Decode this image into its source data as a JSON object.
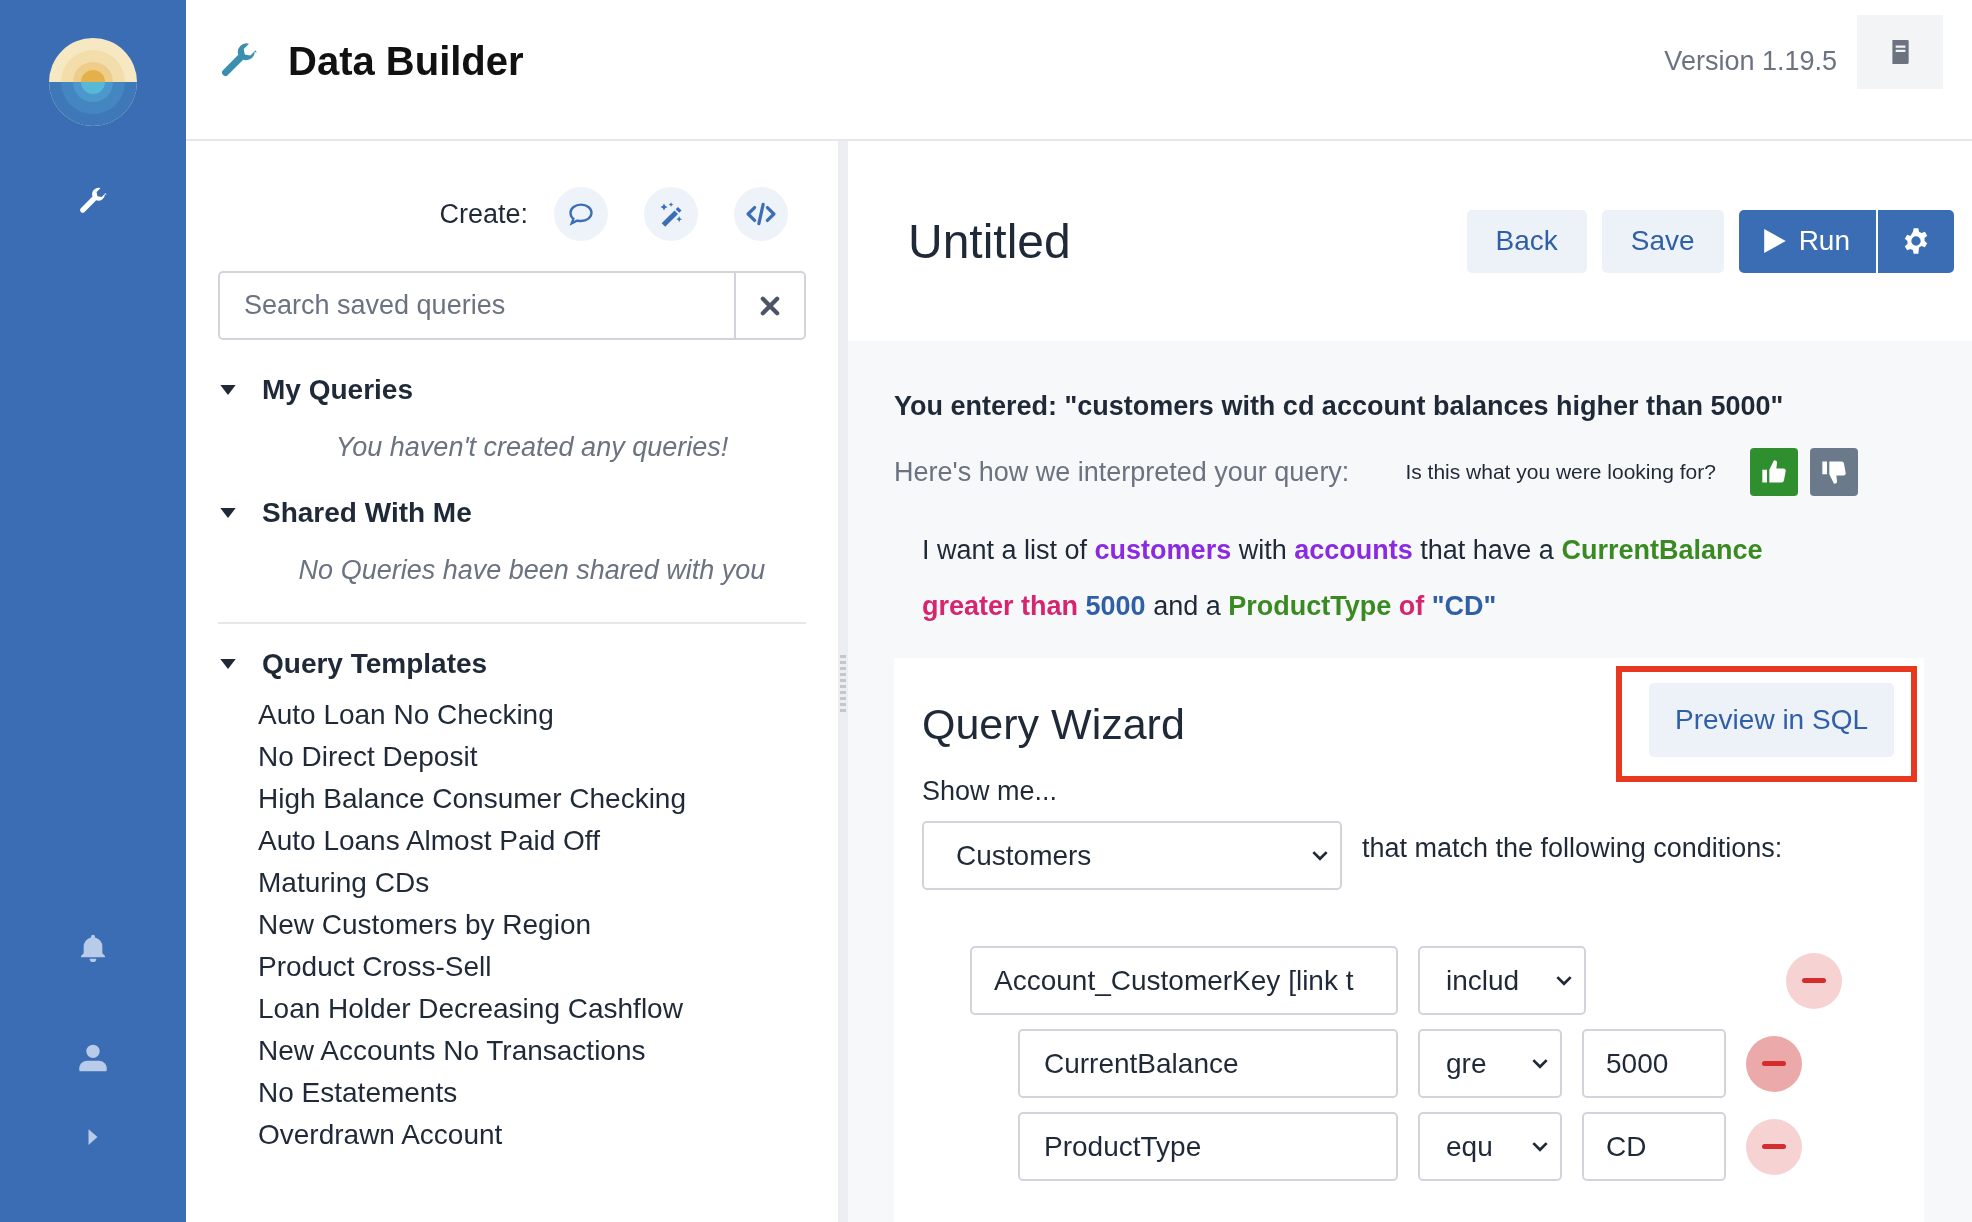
{
  "app": {
    "title": "Data Builder",
    "version": "Version 1.19.5"
  },
  "library": {
    "create_label": "Create:",
    "search": {
      "placeholder": "Search saved queries"
    },
    "sections": [
      {
        "title": "My Queries",
        "expanded": true,
        "empty_message": "You haven't created any queries!"
      },
      {
        "title": "Shared With Me",
        "expanded": true,
        "empty_message": "No Queries have been shared with you"
      },
      {
        "title": "Query Templates",
        "expanded": true,
        "items": [
          "Auto Loan No Checking",
          "No Direct Deposit",
          "High Balance Consumer Checking",
          "Auto Loans Almost Paid Off",
          "Maturing CDs",
          "New Customers by Region",
          "Product Cross-Sell",
          "Loan Holder Decreasing Cashflow",
          "New Accounts No Transactions",
          "No Estatements",
          "Overdrawn Account"
        ]
      }
    ]
  },
  "query": {
    "title": "Untitled",
    "buttons": [
      "Back",
      "Save"
    ],
    "run_button": "Run",
    "entered": "You entered: \"customers with cd account balances higher than 5000\"",
    "interpretation_label": "Here's how we interpreted your query:",
    "feedback_question": "Is this what you were looking for?",
    "feedback": {
      "thumbs_up": true,
      "thumbs_down": false
    },
    "sentence": [
      {
        "kind": "plain",
        "text": "I want a list of"
      },
      {
        "kind": "entity",
        "text": "customers"
      },
      {
        "kind": "plain",
        "text": "with"
      },
      {
        "kind": "entity",
        "text": "accounts"
      },
      {
        "kind": "plain",
        "text": "that have a"
      },
      {
        "kind": "field",
        "text": "CurrentBalance"
      },
      {
        "kind": "operator",
        "text": "greater than"
      },
      {
        "kind": "value",
        "text": "5000"
      },
      {
        "kind": "plain",
        "text": "and a"
      },
      {
        "kind": "field",
        "text": "ProductType"
      },
      {
        "kind": "operator",
        "text": "of"
      },
      {
        "kind": "value",
        "text": "\"CD\""
      }
    ]
  },
  "wizard": {
    "title": "Query Wizard",
    "preview_button": "Preview in SQL",
    "preview_highlighted": true,
    "show_me_label": "Show me...",
    "entity_select": "Customers",
    "match_label": "that match the following conditions:",
    "conditions": [
      {
        "field": "Account_CustomerKey [link t",
        "operator": "includ",
        "hovered": false,
        "children": [
          {
            "field": "CurrentBalance",
            "operator": "gre",
            "value": "5000",
            "hovered": true
          },
          {
            "field": "ProductType",
            "operator": "equ",
            "value": "CD",
            "hovered": false
          }
        ]
      }
    ]
  }
}
